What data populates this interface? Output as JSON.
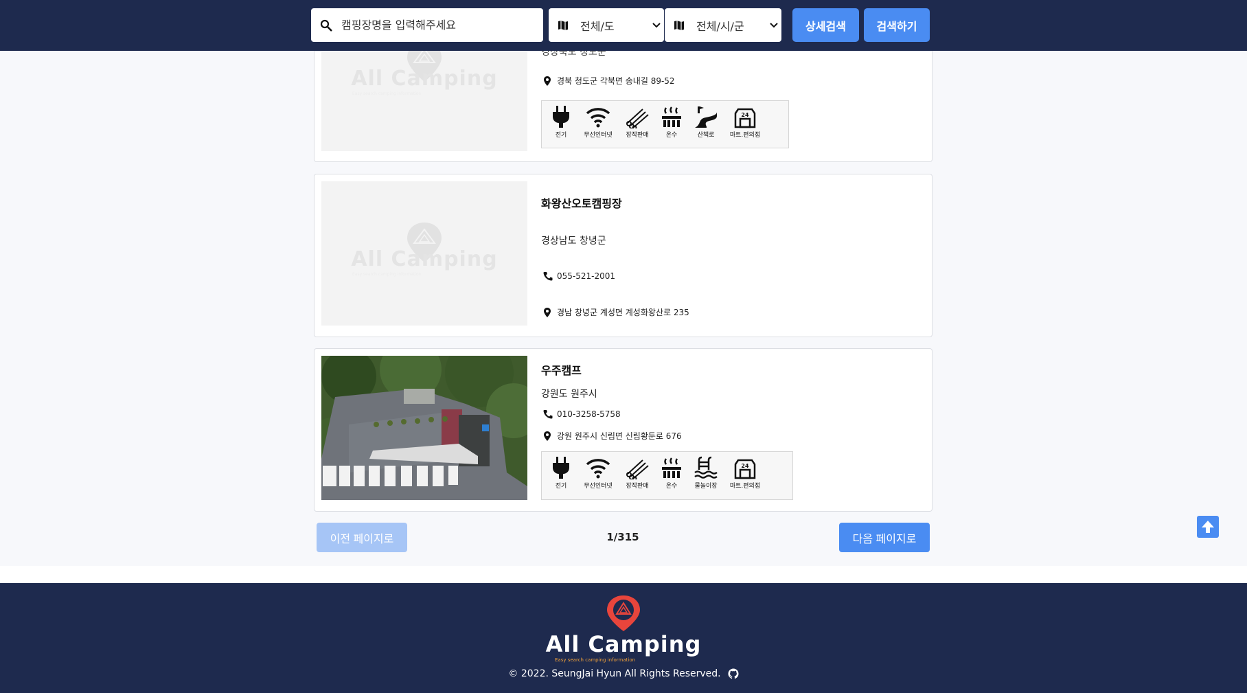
{
  "header": {
    "search_placeholder": "캠핑장명을 입력해주세요",
    "province_select": "전체/도",
    "city_select": "전체/시/군",
    "detail_search_label": "상세검색",
    "search_label": "검색하기"
  },
  "placeholder_image": {
    "brand": "All Camping",
    "tagline": "Easy search camping information"
  },
  "cards": [
    {
      "name": "",
      "region": "경상북도 청도군",
      "phone": "",
      "address": "경북 청도군 각북면 송내길 89-52",
      "amenities": [
        "전기",
        "무선인터넷",
        "장작판매",
        "온수",
        "산책로",
        "마트.편의점"
      ]
    },
    {
      "name": "화왕산오토캠핑장",
      "region": "경상남도 창녕군",
      "phone": "055-521-2001",
      "address": "경남 창녕군 계성면 계성화왕산로 235",
      "amenities": []
    },
    {
      "name": "우주캠프",
      "region": "강원도 원주시",
      "phone": "010-3258-5758",
      "address": "강원 원주시 신림면 신림황둔로 676",
      "amenities": [
        "전기",
        "무선인터넷",
        "장작판매",
        "온수",
        "물놀이장",
        "마트.편의점"
      ]
    }
  ],
  "pagination": {
    "prev_label": "이전 페이지로",
    "page": "1/315",
    "next_label": "다음 페이지로"
  },
  "footer": {
    "brand": "All Camping",
    "tagline": "Easy search camping information",
    "copyright": "© 2022. SeungJai Hyun All Rights Reserved."
  },
  "colors": {
    "navy": "#1e2a4e",
    "accent_blue": "#4a8cf2",
    "logo_red": "#e8453c",
    "tagline_orange": "#f2a23a"
  }
}
